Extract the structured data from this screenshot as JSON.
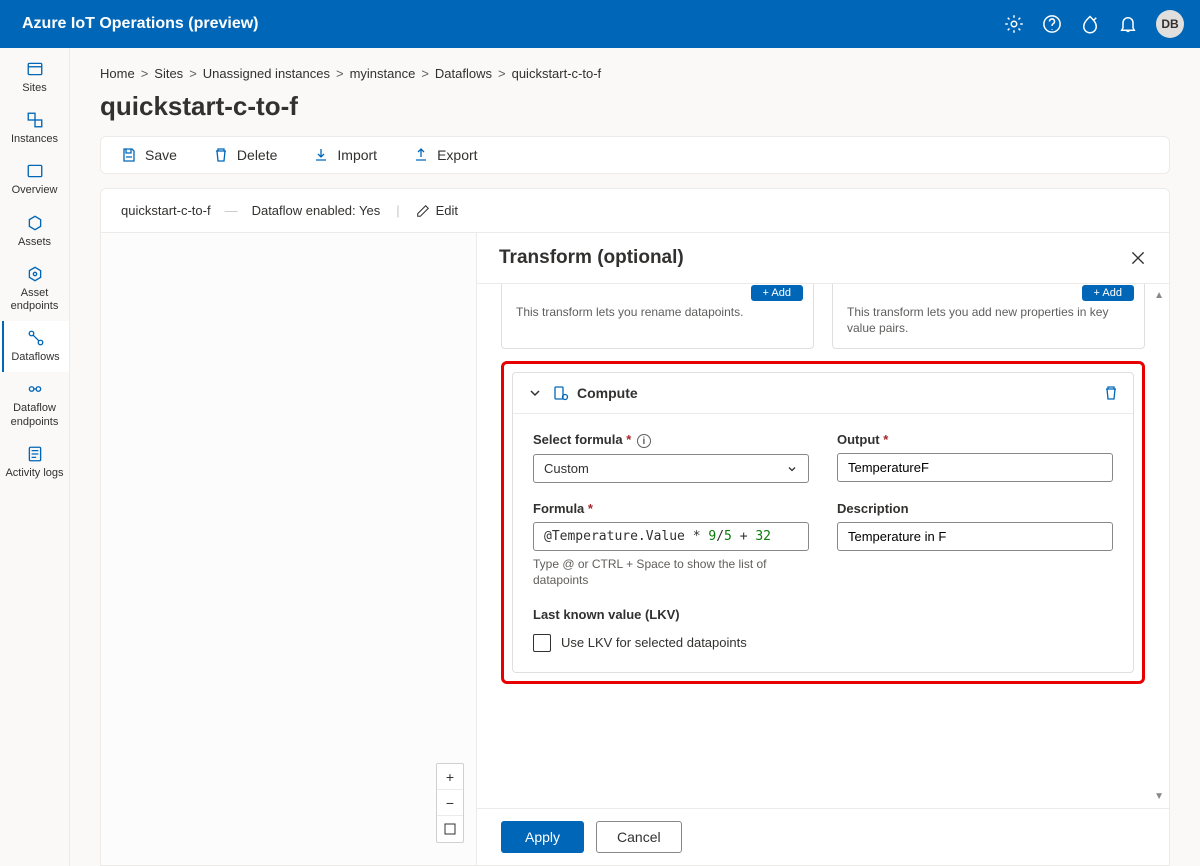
{
  "topbar": {
    "title": "Azure IoT Operations (preview)",
    "avatar": "DB"
  },
  "sidenav": {
    "items": [
      {
        "label": "Sites"
      },
      {
        "label": "Instances"
      },
      {
        "label": "Overview"
      },
      {
        "label": "Assets"
      },
      {
        "label": "Asset endpoints"
      },
      {
        "label": "Dataflows"
      },
      {
        "label": "Dataflow endpoints"
      },
      {
        "label": "Activity logs"
      }
    ],
    "active_index": 5
  },
  "breadcrumbs": [
    "Home",
    "Sites",
    "Unassigned instances",
    "myinstance",
    "Dataflows",
    "quickstart-c-to-f"
  ],
  "page_title": "quickstart-c-to-f",
  "commands": {
    "save": "Save",
    "delete": "Delete",
    "import": "Import",
    "export": "Export"
  },
  "infobar": {
    "name": "quickstart-c-to-f",
    "status": "Dataflow enabled: Yes",
    "edit": "Edit"
  },
  "panel": {
    "title": "Transform (optional)",
    "rename_card": {
      "desc": "This transform lets you rename datapoints."
    },
    "newprop_card": {
      "desc": "This transform lets you add new properties in key value pairs."
    },
    "compute": {
      "title": "Compute",
      "select_formula_label": "Select formula",
      "select_formula_value": "Custom",
      "output_label": "Output",
      "output_value": "TemperatureF",
      "formula_label": "Formula",
      "formula_text_prefix": "@Temperature.Value",
      "formula_n1": "9",
      "formula_n2": "5",
      "formula_n3": "32",
      "formula_full": "@Temperature.Value * 9/5 + 32",
      "formula_hint": "Type @ or CTRL + Space to show the list of datapoints",
      "description_label": "Description",
      "description_value": "Temperature in F",
      "lkv_title": "Last known value (LKV)",
      "lkv_checkbox": "Use LKV for selected datapoints"
    },
    "footer": {
      "apply": "Apply",
      "cancel": "Cancel"
    }
  }
}
